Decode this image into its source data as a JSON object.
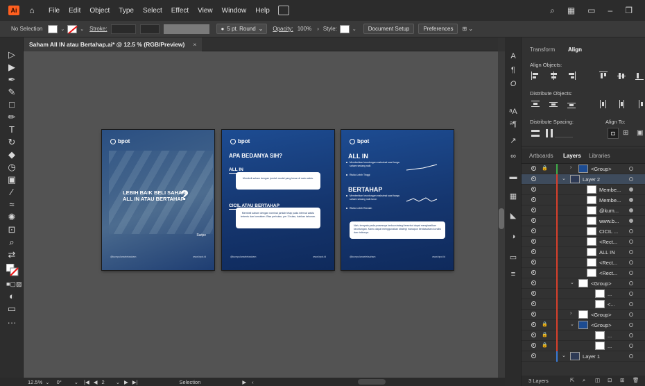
{
  "app": {
    "logo": "Ai",
    "menu": [
      "File",
      "Edit",
      "Object",
      "Type",
      "Select",
      "Effect",
      "View",
      "Window",
      "Help"
    ]
  },
  "control": {
    "selection": "No Selection",
    "stroke_label": "Stroke:",
    "stroke_value": "",
    "brush": "5 pt. Round",
    "opacity_label": "Opacity:",
    "opacity_value": "100%",
    "style_label": "Style:",
    "doc_setup": "Document Setup",
    "preferences": "Preferences"
  },
  "document": {
    "tab_title": "Saham All IN atau Bertahap.ai* @ 12.5 % (RGB/Preview)",
    "close": "×"
  },
  "artboards": {
    "logo_text": "bpot",
    "ab1": {
      "headline": "LEBIH BAIK BELI SAHAM ALL IN ATAU BERTAHAP",
      "qmark": "?",
      "swipe": "Swipe",
      "footer_left": "@kumpulanseleksaham",
      "footer_right": "www.bpot.id"
    },
    "ab2": {
      "heading": "APA BEDANYA SIH?",
      "s1": "ALL IN",
      "s1_text": "Membeli saham dengan jumlah modal yang besar di satu waktu.",
      "s2": "CICIL ATAU BERTAHAP",
      "s2_text": "Membeli saham dengan nominal jumlah tetap pada interval waktu tertentu dan konsisten. Bisa perbulan, per 3 bulan, bahkan tahunan.",
      "footer_left": "@kumpulanseleksaham",
      "footer_right": "www.bpot.id"
    },
    "ab3": {
      "h1": "ALL IN",
      "b1": "Memberikan keuntungan maksimal saat harga saham sedang naik",
      "b2": "Risiko Lebih Tinggi",
      "h2": "BERTAHAP",
      "b3": "Memberikan keuntungan maksimal saat harga saham sedang naik turun",
      "b4": "Risiko Lebih Rendah",
      "note": "Nah, ternyata pada prosesnya kedua strategi tersebut dapat menghasilkan keuntungan. Kamu dapat menggunakan strategi manapun berdasarkan kondisi dan risikonya.",
      "footer_left": "@kumpulanseleksaham",
      "footer_right": "www.bpot.id"
    }
  },
  "status": {
    "zoom": "12.5%",
    "rotate": "0°",
    "page": "2",
    "tool": "Selection"
  },
  "panel": {
    "tabs": [
      "Transform",
      "Align"
    ],
    "align_objects": "Align Objects:",
    "distribute_objects": "Distribute Objects:",
    "distribute_spacing": "Distribute Spacing:",
    "align_to": "Align To:",
    "layer_tabs": [
      "Artboards",
      "Layers",
      "Libraries"
    ],
    "layers": [
      {
        "name": "<Group>",
        "indent": 1,
        "lock": true,
        "twirl": "›",
        "color": "#3fae49"
      },
      {
        "name": "Layer 2",
        "indent": 0,
        "lock": false,
        "twirl": "⌄",
        "color": "#d9402c",
        "selected": true
      },
      {
        "name": "Membe...",
        "indent": 2,
        "lock": false,
        "twirl": "",
        "color": "#d9402c",
        "filled": true
      },
      {
        "name": "Membe...",
        "indent": 2,
        "lock": false,
        "twirl": "",
        "color": "#d9402c",
        "filled": true
      },
      {
        "name": "@kum...",
        "indent": 2,
        "lock": false,
        "twirl": "",
        "color": "#d9402c",
        "filled": true
      },
      {
        "name": "www.b...",
        "indent": 2,
        "lock": false,
        "twirl": "",
        "color": "#d9402c",
        "filled": true
      },
      {
        "name": "CICIL ...",
        "indent": 2,
        "lock": false,
        "twirl": "",
        "color": "#d9402c"
      },
      {
        "name": "<Rect...",
        "indent": 2,
        "lock": false,
        "twirl": "",
        "color": "#d9402c"
      },
      {
        "name": "ALL IN",
        "indent": 2,
        "lock": false,
        "twirl": "",
        "color": "#d9402c"
      },
      {
        "name": "<Rect...",
        "indent": 2,
        "lock": false,
        "twirl": "",
        "color": "#d9402c"
      },
      {
        "name": "<Rect...",
        "indent": 2,
        "lock": false,
        "twirl": "",
        "color": "#d9402c"
      },
      {
        "name": "<Group>",
        "indent": 1,
        "lock": false,
        "twirl": "⌄",
        "color": "#d9402c"
      },
      {
        "name": "...",
        "indent": 3,
        "lock": false,
        "twirl": "",
        "color": "#d9402c"
      },
      {
        "name": "<...",
        "indent": 3,
        "lock": false,
        "twirl": "",
        "color": "#d9402c"
      },
      {
        "name": "<Group>",
        "indent": 1,
        "lock": false,
        "twirl": "›",
        "color": "#d9402c"
      },
      {
        "name": "<Group>",
        "indent": 1,
        "lock": true,
        "twirl": "⌄",
        "color": "#d9402c"
      },
      {
        "name": "...",
        "indent": 3,
        "lock": true,
        "twirl": "",
        "color": "#d9402c"
      },
      {
        "name": "...",
        "indent": 3,
        "lock": true,
        "twirl": "",
        "color": "#d9402c"
      },
      {
        "name": "Layer 1",
        "indent": 0,
        "lock": false,
        "twirl": "⌄",
        "color": "#3a7bd5"
      }
    ],
    "layer_count": "3 Layers"
  }
}
